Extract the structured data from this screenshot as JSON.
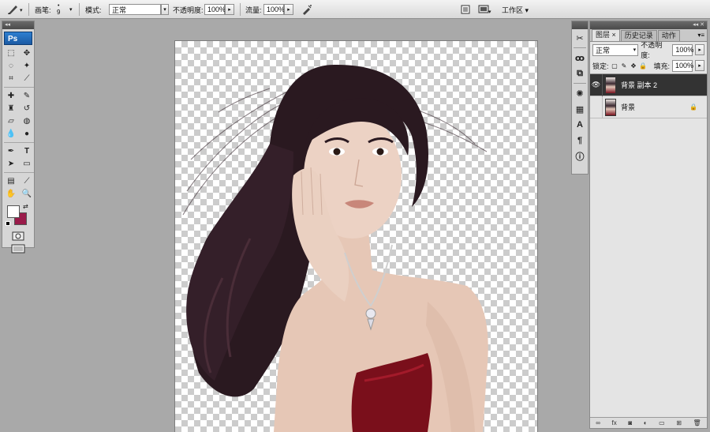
{
  "options_bar": {
    "brush_label": "画笔:",
    "brush_size": "9",
    "mode_label": "模式:",
    "mode_value": "正常",
    "opacity_label": "不透明度:",
    "opacity_value": "100%",
    "flow_label": "流量:",
    "flow_value": "100%",
    "workspace_label": "工作区 ▾"
  },
  "tools_panel": {
    "header_label": "◂◂",
    "logo": "Ps",
    "foreground_color": "#ffffff",
    "background_color": "#9a1b4a"
  },
  "canvas": {
    "transparent_checker": true
  },
  "layers_panel": {
    "header_label": "◂◂ ✕",
    "tabs": [
      {
        "label": "图层 ×",
        "active": true
      },
      {
        "label": "历史记录",
        "active": false
      },
      {
        "label": "动作",
        "active": false
      }
    ],
    "blend_mode": "正常",
    "opacity_label": "不透明度:",
    "opacity_value": "100%",
    "lock_label": "锁定:",
    "fill_label": "填充:",
    "fill_value": "100%",
    "layers": [
      {
        "name": "背景 副本 2",
        "visible": true,
        "selected": true
      },
      {
        "name": "背景",
        "visible": false,
        "selected": false,
        "locked": true
      }
    ]
  }
}
